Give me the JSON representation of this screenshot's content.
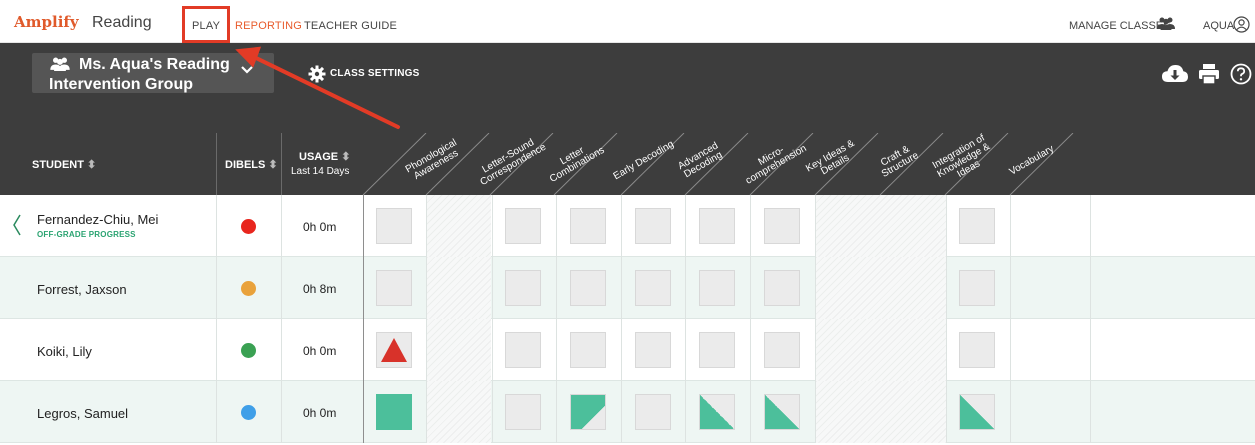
{
  "nav": {
    "brand": "Amplify",
    "product": "Reading",
    "links": [
      {
        "label": "PLAY",
        "active": false
      },
      {
        "label": "REPORTING",
        "active": true
      },
      {
        "label": "TEACHER GUIDE",
        "active": false
      }
    ],
    "manage_label": "MANAGE CLASSES",
    "user_label": "AQUA"
  },
  "header": {
    "class_name": "Ms. Aqua's Reading Intervention Group",
    "settings_label": "CLASS SETTINGS"
  },
  "table": {
    "col_student": "STUDENT",
    "col_dibels": "DIBELS",
    "col_usage": "USAGE",
    "col_usage_sub": "Last 14 Days",
    "skills": [
      [
        "Phonological",
        "Awareness"
      ],
      [
        "Letter-Sound",
        "Correspondence"
      ],
      [
        "Letter",
        "Combinations"
      ],
      [
        "Early Decoding"
      ],
      [
        "Advanced",
        "Decoding"
      ],
      [
        "Micro-",
        "comprehension"
      ],
      [
        "Key Ideas &",
        "Details"
      ],
      [
        "Craft &",
        "Structure"
      ],
      [
        "Integration of",
        "Knowledge &",
        "Ideas"
      ],
      [
        "Vocabulary"
      ]
    ],
    "rows": [
      {
        "name": "Fernandez-Chiu, Mei",
        "sub": "OFF-GRADE PROGRESS",
        "dibels": "#e8261e",
        "usage": "0h 0m",
        "cells": [
          "empty",
          "hatch",
          "empty",
          "empty",
          "empty",
          "empty",
          "empty",
          "hatch",
          "empty",
          "none"
        ]
      },
      {
        "name": "Forrest, Jaxson",
        "sub": "",
        "dibels": "#e9a23b",
        "usage": "0h 8m",
        "cells": [
          "empty",
          "hatch",
          "empty",
          "empty",
          "empty",
          "empty",
          "empty",
          "hatch",
          "empty",
          "none"
        ]
      },
      {
        "name": "Koiki, Lily",
        "sub": "",
        "dibels": "#3aa153",
        "usage": "0h 0m",
        "cells": [
          "triangle",
          "hatch",
          "empty",
          "empty",
          "empty",
          "empty",
          "empty",
          "hatch",
          "empty",
          "none"
        ]
      },
      {
        "name": "Legros, Samuel",
        "sub": "",
        "dibels": "#3f9fe8",
        "usage": "0h 0m",
        "cells": [
          "full",
          "hatch",
          "empty",
          "large-corner",
          "empty",
          "small-corner",
          "small-corner",
          "hatch",
          "small-corner",
          "none"
        ]
      }
    ]
  },
  "colors": {
    "accent": "#e85b2c",
    "header_bg": "#3d3d3d",
    "teal": "#4cbf9b",
    "alert": "#d8322a",
    "annotation": "#e23b26"
  }
}
